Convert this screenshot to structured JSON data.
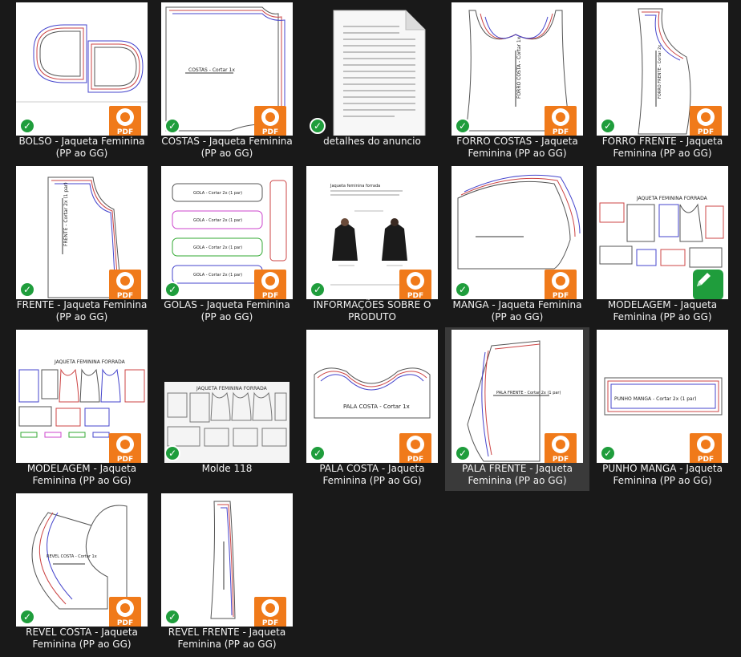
{
  "files": [
    {
      "id": "bolso",
      "label": "BOLSO - Jaqueta Feminina (PP ao GG)",
      "badge": "pdf",
      "thumb_text": ""
    },
    {
      "id": "costas",
      "label": "COSTAS - Jaqueta Feminina (PP ao GG)",
      "badge": "pdf",
      "thumb_text": "COSTAS - Cortar 1x"
    },
    {
      "id": "detalhes",
      "label": "detalhes do anuncio",
      "badge": "none",
      "thumb_text": ""
    },
    {
      "id": "forro-costas",
      "label": "FORRO COSTAS - Jaqueta Feminina (PP ao GG)",
      "badge": "pdf",
      "thumb_text": "FORRO COSTA - Cortar 1x"
    },
    {
      "id": "forro-frente",
      "label": "FORRO FRENTE - Jaqueta Feminina (PP ao GG)",
      "badge": "pdf",
      "thumb_text": "FORRO FRENTE - Cortar 2x"
    },
    {
      "id": "frente",
      "label": "FRENTE - Jaqueta Feminina (PP ao GG)",
      "badge": "pdf",
      "thumb_text": "FRENTE - Cortar 2x (1 par)"
    },
    {
      "id": "golas",
      "label": "GOLAS - Jaqueta Feminina (PP ao GG)",
      "badge": "pdf",
      "thumb_text": "GOLA - Cortar 2x (1 par)"
    },
    {
      "id": "informacoes",
      "label": "INFORMAÇÕES SOBRE O PRODUTO",
      "badge": "pdf",
      "thumb_text": "Jaqueta feminina forrada"
    },
    {
      "id": "manga",
      "label": "MANGA - Jaqueta Feminina (PP ao GG)",
      "badge": "pdf",
      "thumb_text": ""
    },
    {
      "id": "modelagem-1",
      "label": "MODELAGEM - Jaqueta Feminina (PP ao GG)",
      "badge": "pen",
      "thumb_text": "JAQUETA FEMININA FORRADA"
    },
    {
      "id": "modelagem-2",
      "label": "MODELAGEM - Jaqueta Feminina (PP ao GG)",
      "badge": "pdf",
      "thumb_text": "JAQUETA FEMININA FORRADA"
    },
    {
      "id": "molde",
      "label": "Molde 118",
      "badge": "none",
      "thumb_text": "JAQUETA FEMININA FORRADA"
    },
    {
      "id": "pala-costa",
      "label": "PALA COSTA - Jaqueta Feminina (PP ao GG)",
      "badge": "pdf",
      "thumb_text": "PALA COSTA - Cortar 1x"
    },
    {
      "id": "pala-frente",
      "label": "PALA FRENTE - Jaqueta Feminina (PP ao GG)",
      "badge": "pdf",
      "thumb_text": "PALA FRENTE - Cortar 2x (1 par)"
    },
    {
      "id": "punho-manga",
      "label": "PUNHO MANGA - Jaqueta Feminina (PP ao GG)",
      "badge": "pdf",
      "thumb_text": "PUNHO MANGA - Cortar 2x (1 par)"
    },
    {
      "id": "revel-costa",
      "label": "REVEL COSTA - Jaqueta Feminina (PP ao GG)",
      "badge": "pdf",
      "thumb_text": "REVEL COSTA - Cortar 1x"
    },
    {
      "id": "revel-frente",
      "label": "REVEL FRENTE - Jaqueta Feminina (PP ao GG)",
      "badge": "pdf",
      "thumb_text": ""
    }
  ],
  "pdf_badge_text": "PDF",
  "selected_id": "pala-frente",
  "colors": {
    "background": "#191919",
    "selected": "#3a3a3a",
    "pdf_orange": "#f07a1a",
    "sync_green": "#1f9d3c"
  }
}
